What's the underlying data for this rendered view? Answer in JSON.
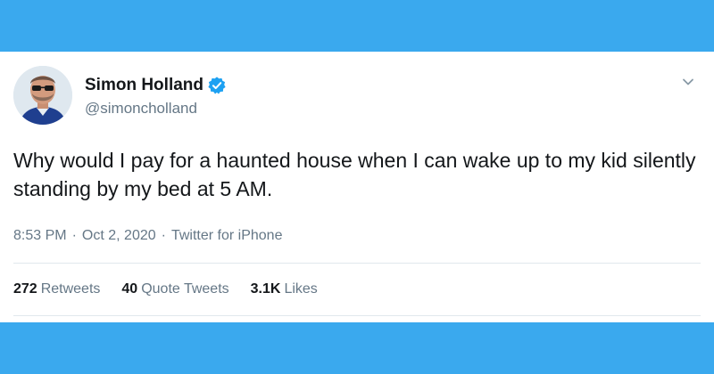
{
  "colors": {
    "brand_blue": "#39a9ef",
    "verified_blue": "#1da1f2",
    "text_primary": "#14171a",
    "text_secondary": "#657786",
    "divider": "#e1e8ed"
  },
  "tweet": {
    "author": {
      "display_name": "Simon Holland",
      "handle": "@simoncholland",
      "verified": true,
      "avatar_icon": "profile-photo"
    },
    "menu_icon": "chevron-down-icon",
    "text": "Why would I pay for a haunted house when I can wake up to my kid silently standing by my bed at 5 AM.",
    "meta": {
      "time": "8:53 PM",
      "separator": "·",
      "date": "Oct 2, 2020",
      "source": "Twitter for iPhone"
    },
    "stats": {
      "retweets": {
        "count": "272",
        "label": "Retweets"
      },
      "quote_tweets": {
        "count": "40",
        "label": "Quote Tweets"
      },
      "likes": {
        "count": "3.1K",
        "label": "Likes"
      }
    }
  }
}
